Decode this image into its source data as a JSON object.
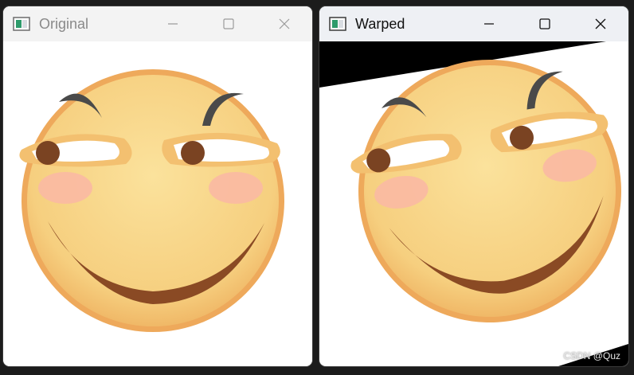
{
  "windows": {
    "original": {
      "title": "Original",
      "content": "emoji-image"
    },
    "warped": {
      "title": "Warped",
      "content": "warped-emoji-image"
    }
  },
  "controls": [
    "minimize-icon",
    "maximize-icon",
    "close-icon"
  ],
  "icons": {
    "app": "app-window-icon"
  },
  "watermark": {
    "text": "CSDN @Quz"
  },
  "colors": {
    "face": "#f8d98c",
    "face_edge": "#eea95b",
    "eyebrow": "#4a4a4a",
    "pupil": "#7a4322",
    "blush": "#f9b9a3",
    "mouth": "#8a4a24",
    "desktop": "#1c1c1c"
  }
}
